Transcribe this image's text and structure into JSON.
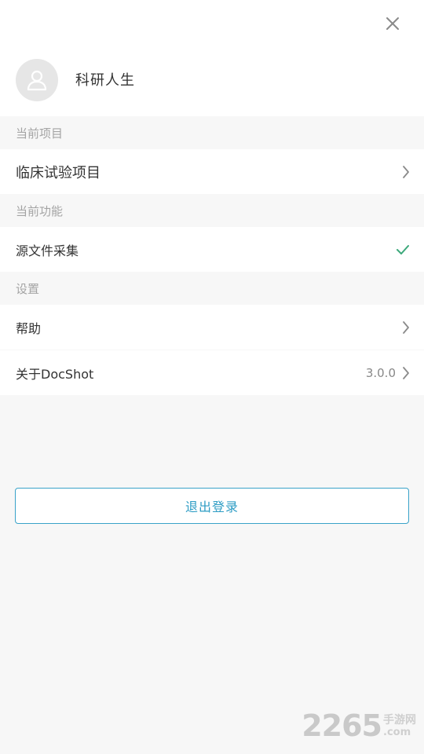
{
  "profile": {
    "username": "科研人生"
  },
  "sections": {
    "current_project": {
      "header": "当前项目",
      "item_label": "临床试验项目"
    },
    "current_function": {
      "header": "当前功能",
      "item_label": "源文件采集"
    },
    "settings": {
      "header": "设置",
      "help_label": "帮助",
      "about_label": "关于DocShot",
      "about_version": "3.0.0"
    }
  },
  "logout": {
    "label": "退出登录"
  },
  "watermark": {
    "number": "2265",
    "site": "手游网",
    "domain": ".com"
  },
  "colors": {
    "accent": "#2d9cc4",
    "check": "#3ba87a",
    "icon_gray": "#8a8a8a"
  },
  "icons": [
    "close-icon",
    "user-icon",
    "chevron-right-icon",
    "checkmark-icon"
  ]
}
